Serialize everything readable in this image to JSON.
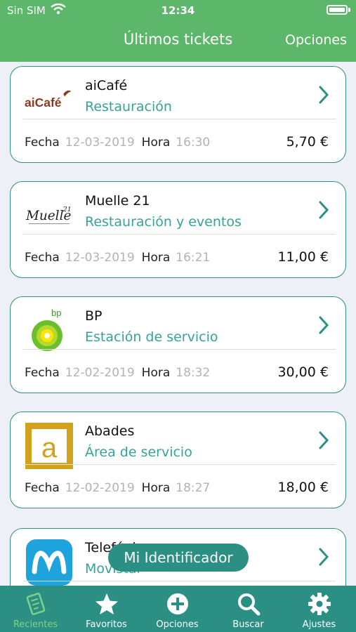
{
  "status": {
    "carrier": "Sin SIM",
    "time": "12:34"
  },
  "header": {
    "title": "Últimos tickets",
    "options_label": "Opciones"
  },
  "labels": {
    "date": "Fecha",
    "time": "Hora"
  },
  "tickets": [
    {
      "name": "aiCafé",
      "category": "Restauración",
      "date": "12-03-2019",
      "time": "16:30",
      "amount": "5,70 €",
      "logo": "aicafe-logo"
    },
    {
      "name": "Muelle 21",
      "category": "Restauración y eventos",
      "date": "12-03-2019",
      "time": "16:21",
      "amount": "11,00 €",
      "logo": "muelle21-logo"
    },
    {
      "name": "BP",
      "category": "Estación de servicio",
      "date": "12-02-2019",
      "time": "18:32",
      "amount": "30,00 €",
      "logo": "bp-logo"
    },
    {
      "name": "Abades",
      "category": "Área de servicio",
      "date": "12-02-2019",
      "time": "18:27",
      "amount": "18,00 €",
      "logo": "abades-logo"
    },
    {
      "name": "Telefónica",
      "category": "Movistar",
      "logo": "movistar-logo"
    }
  ],
  "logo_text": {
    "aicafe": "aiCafé",
    "muelle": "Muelle",
    "muelle_num": "21",
    "bp": "bp",
    "abades": "a"
  },
  "floating_button": {
    "label": "Mi Identificador"
  },
  "tabbar": {
    "items": [
      {
        "label": "Recientes",
        "icon": "receipt-icon",
        "active": true
      },
      {
        "label": "Favoritos",
        "icon": "star-icon"
      },
      {
        "label": "Opciones",
        "icon": "plus-circle-icon"
      },
      {
        "label": "Buscar",
        "icon": "search-icon"
      },
      {
        "label": "Ajustes",
        "icon": "gear-icon"
      }
    ]
  },
  "colors": {
    "header": "#5cb76a",
    "accent": "#2c8f84",
    "category": "#36a397",
    "active_tab": "#7bd38a"
  }
}
